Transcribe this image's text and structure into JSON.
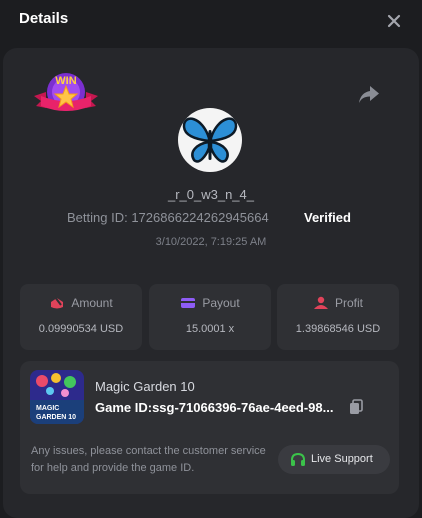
{
  "header": {
    "title": "Details"
  },
  "badge": {
    "text": "WIN"
  },
  "user": {
    "name": "_r_0_w3_n_4_",
    "betting_id_label": "Betting ID:",
    "betting_id": "1726866224262945664",
    "verified": "Verified",
    "date": "3/10/2022, 7:19:25 AM"
  },
  "stats": [
    {
      "label": "Amount",
      "value": "0.09990534 USD",
      "icon": "amount-icon",
      "color": "#e0435a"
    },
    {
      "label": "Payout",
      "value": "15.0001 x",
      "icon": "payout-card-icon",
      "color": "#8e5cf5"
    },
    {
      "label": "Profit",
      "value": "1.39868546 USD",
      "icon": "profit-user-icon",
      "color": "#e0435a"
    }
  ],
  "game": {
    "thumb_text": "MAGIC GARDEN 10",
    "name": "Magic Garden 10",
    "id_label": "Game ID:",
    "id": "ssg-71066396-76ae-4eed-98...",
    "help_text": "Any issues, please contact the customer service for help and provide the game ID.",
    "support_label": "Live Support",
    "support_icon_color": "#3bc24a"
  }
}
